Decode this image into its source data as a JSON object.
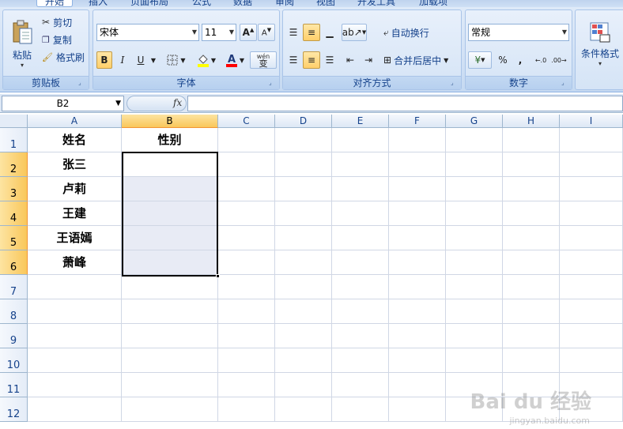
{
  "tabs": [
    "开始",
    "插入",
    "页面布局",
    "公式",
    "数据",
    "审阅",
    "视图",
    "开发工具",
    "加载项"
  ],
  "clipboard": {
    "paste": "粘贴",
    "cut": "剪切",
    "copy": "复制",
    "format_painter": "格式刷",
    "label": "剪贴板"
  },
  "font": {
    "name": "宋体",
    "size": "11",
    "bold": "B",
    "italic": "I",
    "underline": "U",
    "wen": "wén",
    "wen_char": "变",
    "label": "字体"
  },
  "alignment": {
    "wrap": "自动换行",
    "merge": "合并后居中",
    "label": "对齐方式"
  },
  "number": {
    "format": "常规",
    "percent": "%",
    "comma": ",",
    "label": "数字"
  },
  "styles": {
    "cond_format": "条件格式"
  },
  "formula_bar": {
    "name_box": "B2",
    "fx": "fx",
    "content": ""
  },
  "columns": [
    "A",
    "B",
    "C",
    "D",
    "E",
    "F",
    "G",
    "H",
    "I"
  ],
  "rows": [
    "1",
    "2",
    "3",
    "4",
    "5",
    "6",
    "7",
    "8",
    "9",
    "10",
    "11",
    "12"
  ],
  "cells": {
    "A1": "姓名",
    "B1": "性别",
    "A2": "张三",
    "A3": "卢莉",
    "A4": "王建",
    "A5": "王语嫣",
    "A6": "萧峰"
  },
  "selection": {
    "active_cell": "B2",
    "range": "B2:B6"
  },
  "watermark": {
    "logo": "Bai du 经验",
    "url": "jingyan.baidu.com"
  },
  "colors": {
    "ribbon": "#d1e1f5",
    "selected_header": "#f9c75b",
    "selection_fill": "#e8ebf5",
    "gridline": "#d0d7e5"
  }
}
